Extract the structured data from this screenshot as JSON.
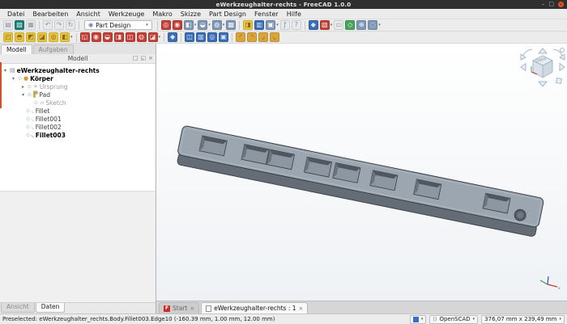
{
  "window": {
    "title": "eWerkzeughalter-rechts - FreeCAD 1.0.0",
    "controls": {
      "minimize": "–",
      "maximize": "□",
      "close": "×"
    }
  },
  "menubar": {
    "items": [
      "Datei",
      "Bearbeiten",
      "Ansicht",
      "Werkzeuge",
      "Makro",
      "Skizze",
      "Part Design",
      "Fenster",
      "Hilfe"
    ]
  },
  "glyphs": {
    "dropdown": "▾",
    "expand_open": "▾",
    "expand_closed": "▸",
    "visibility": "⊙",
    "panel_float": "□",
    "panel_restore": "◱",
    "panel_close": "×",
    "tab_close": "×",
    "combo_icon": "◉"
  },
  "toolbar_standard": {
    "workbench_selector": "Part Design",
    "icons": [
      {
        "name": "new-file-icon",
        "glyph": "▤"
      },
      {
        "name": "open-file-icon",
        "glyph": "▨"
      },
      {
        "name": "save-icon",
        "glyph": "▦"
      },
      {
        "name": "undo-icon",
        "glyph": "↶"
      },
      {
        "name": "redo-icon",
        "glyph": "↷"
      },
      {
        "name": "refresh-icon",
        "glyph": "↻"
      },
      {
        "name": "fit-all-icon",
        "glyph": "◎"
      },
      {
        "name": "zoom-selection-icon",
        "glyph": "◉"
      },
      {
        "name": "std-views-icon",
        "glyph": "◧"
      },
      {
        "name": "rotate-view-icon",
        "glyph": "◒"
      },
      {
        "name": "draw-style-icon",
        "glyph": "◍"
      },
      {
        "name": "texture-view-icon",
        "glyph": "▩"
      },
      {
        "name": "appearance-icon",
        "glyph": "◨"
      },
      {
        "name": "dependency-graph-icon",
        "glyph": "▥"
      },
      {
        "name": "link-make-icon",
        "glyph": "▣"
      },
      {
        "name": "expression-icon",
        "glyph": "ƒ"
      },
      {
        "name": "whats-this-icon",
        "glyph": "?"
      },
      {
        "name": "std-part-icon",
        "glyph": "◆"
      },
      {
        "name": "image-plane-icon",
        "glyph": "▧"
      },
      {
        "name": "group-icon",
        "glyph": "▭"
      },
      {
        "name": "measure-icon",
        "glyph": "◇"
      },
      {
        "name": "axis-cross-icon",
        "glyph": "⊕"
      },
      {
        "name": "clear-measure-icon",
        "glyph": "◌"
      }
    ]
  },
  "toolbar_partdesign": {
    "icons": [
      {
        "name": "pad-icon",
        "glyph": "◰"
      },
      {
        "name": "revolution-icon",
        "glyph": "◓"
      },
      {
        "name": "additive-loft-icon",
        "glyph": "◩"
      },
      {
        "name": "additive-pipe-icon",
        "glyph": "◪"
      },
      {
        "name": "additive-helix-icon",
        "glyph": "◎"
      },
      {
        "name": "additive-primitive-icon",
        "glyph": "◧"
      },
      {
        "name": "pocket-icon",
        "glyph": "◱"
      },
      {
        "name": "hole-icon",
        "glyph": "◉"
      },
      {
        "name": "groove-icon",
        "glyph": "◒"
      },
      {
        "name": "subtractive-loft-icon",
        "glyph": "◨"
      },
      {
        "name": "subtractive-pipe-icon",
        "glyph": "◫"
      },
      {
        "name": "subtractive-helix-icon",
        "glyph": "◍"
      },
      {
        "name": "subtractive-primitive-icon",
        "glyph": "◪"
      },
      {
        "name": "boolean-icon",
        "glyph": "◆"
      },
      {
        "name": "mirrored-icon",
        "glyph": "◫"
      },
      {
        "name": "linear-pattern-icon",
        "glyph": "▥"
      },
      {
        "name": "polar-pattern-icon",
        "glyph": "◎"
      },
      {
        "name": "multitransform-icon",
        "glyph": "▣"
      },
      {
        "name": "fillet-tool-icon",
        "glyph": "◜"
      },
      {
        "name": "chamfer-tool-icon",
        "glyph": "◝"
      },
      {
        "name": "draft-tool-icon",
        "glyph": "◞"
      },
      {
        "name": "thickness-tool-icon",
        "glyph": "◟"
      }
    ]
  },
  "left_panel": {
    "top_tabs": [
      "Modell",
      "Aufgaben"
    ],
    "header_title": "Modell",
    "tree_items": [
      {
        "label": "eWerkzeughalter-rechts",
        "icon": "▤"
      },
      {
        "label": "Körper",
        "icon": "●"
      },
      {
        "label": "Ursprung",
        "icon": "+"
      },
      {
        "label": "Pad",
        "icon": "▛"
      },
      {
        "label": "Sketch",
        "icon": "▱"
      },
      {
        "label": "Fillet",
        "icon": "◟"
      },
      {
        "label": "Fillet001",
        "icon": "◟"
      },
      {
        "label": "Fillet002",
        "icon": "◟"
      },
      {
        "label": "Fillet003",
        "icon": "◟"
      }
    ],
    "bottom_tabs": [
      "Ansicht",
      "Daten"
    ]
  },
  "viewport": {
    "nav_cube_label": "OBEN",
    "axis_label_x": "x",
    "doc_tabs": [
      {
        "label": "Start"
      },
      {
        "label": "eWerkzeughalter-rechts : 1"
      }
    ]
  },
  "statusbar": {
    "message": "Preselected: eWerkzeughalter_rechts.Body.Fillet003.Edge10 (-160.39 mm, 1.00 mm, 12.00 mm)",
    "openscad_icon": "()",
    "openscad_label": "OpenSCAD",
    "dimensions": "376,07 mm x 239,49 mm"
  },
  "colors": {
    "titlebar_close": "#e95420",
    "model_top": "#9ca6b0",
    "model_front": "#646c76",
    "edge_strip": "#d4502a",
    "swatch_blue": "#3b6ec9"
  }
}
